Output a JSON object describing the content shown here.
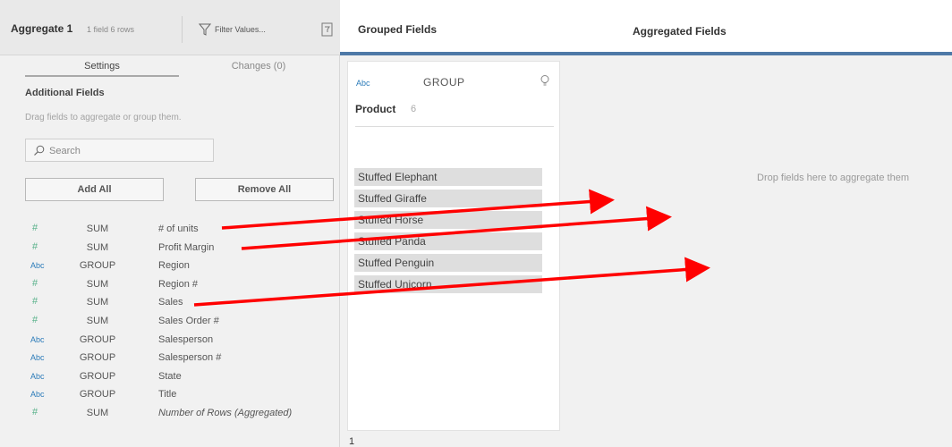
{
  "toolbar": {
    "title": "Aggregate 1",
    "meta": "1 field  6 rows",
    "filter_label": "Filter Values..."
  },
  "tabs": [
    {
      "label": "Settings"
    },
    {
      "label": "Changes (0)"
    }
  ],
  "additional_fields": {
    "title": "Additional Fields",
    "hint": "Drag fields to aggregate or group them.",
    "search_placeholder": "Search",
    "add_all_label": "Add All",
    "remove_all_label": "Remove All",
    "fields": [
      {
        "type": "#",
        "agg": "SUM",
        "name": "# of units"
      },
      {
        "type": "#",
        "agg": "SUM",
        "name": "Profit Margin"
      },
      {
        "type": "Abc",
        "agg": "GROUP",
        "name": "Region"
      },
      {
        "type": "#",
        "agg": "SUM",
        "name": "Region #"
      },
      {
        "type": "#",
        "agg": "SUM",
        "name": "Sales"
      },
      {
        "type": "#",
        "agg": "SUM",
        "name": "Sales Order #"
      },
      {
        "type": "Abc",
        "agg": "GROUP",
        "name": "Salesperson"
      },
      {
        "type": "Abc",
        "agg": "GROUP",
        "name": "Salesperson #"
      },
      {
        "type": "Abc",
        "agg": "GROUP",
        "name": "State"
      },
      {
        "type": "Abc",
        "agg": "GROUP",
        "name": "Title"
      },
      {
        "type": "#",
        "agg": "SUM",
        "name": "Number of Rows (Aggregated)"
      }
    ]
  },
  "grouped_fields": {
    "header": "Grouped Fields",
    "card": {
      "type": "Abc",
      "role": "GROUP",
      "field_name": "Product",
      "count": "6",
      "values": [
        "Stuffed Elephant",
        "Stuffed Giraffe",
        "Stuffed Horse",
        "Stuffed Panda",
        "Stuffed Penguin",
        "Stuffed Unicorn"
      ]
    }
  },
  "aggregated_fields": {
    "header": "Aggregated Fields",
    "drop_hint": "Drop fields here to aggregate them"
  },
  "colors": {
    "accent_bar": "#4e79a7",
    "annotation_arrow": "#ff0000",
    "number_type": "#55b088",
    "string_type": "#2b7bb9"
  },
  "footer_mark": "1"
}
